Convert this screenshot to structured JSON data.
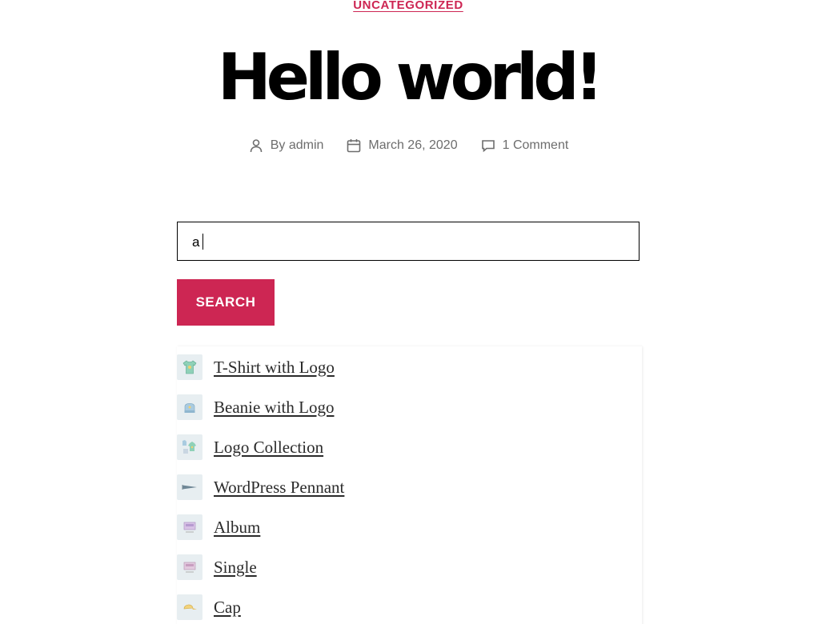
{
  "post": {
    "category": "UNCATEGORIZED",
    "title": "Hello world!",
    "author": "By admin",
    "date": "March 26, 2020",
    "comments": "1 Comment"
  },
  "search": {
    "value": "a",
    "button_label": "SEARCH"
  },
  "results": [
    {
      "label": "T-Shirt with Logo",
      "icon": "tshirt-icon"
    },
    {
      "label": "Beanie with Logo",
      "icon": "beanie-icon"
    },
    {
      "label": "Logo Collection",
      "icon": "collection-icon"
    },
    {
      "label": "WordPress Pennant",
      "icon": "pennant-icon"
    },
    {
      "label": "Album",
      "icon": "album-icon"
    },
    {
      "label": "Single",
      "icon": "single-icon"
    },
    {
      "label": "Cap",
      "icon": "cap-icon"
    }
  ],
  "colors": {
    "accent": "#cd2653",
    "meta_text": "#6d6d6d",
    "thumb_bg": "#e7eef1"
  }
}
